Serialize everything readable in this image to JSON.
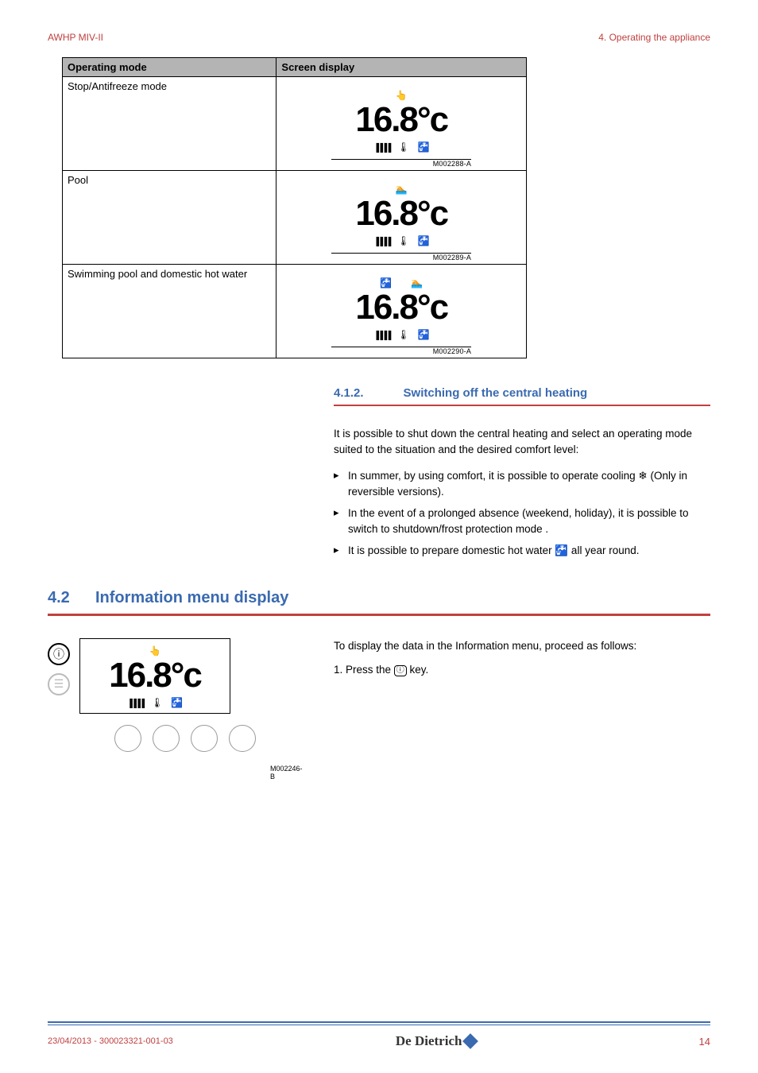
{
  "header": {
    "left": "AWHP MIV-II",
    "right": "4.  Operating the appliance"
  },
  "table": {
    "headers": {
      "mode": "Operating mode",
      "display": "Screen display"
    },
    "rows": [
      {
        "mode": "Stop/Antifreeze mode",
        "top_icons": [
          "hand"
        ],
        "temp": "16.8°c",
        "ref": "M002288-A"
      },
      {
        "mode": "Pool",
        "top_icons": [
          "pool"
        ],
        "temp": "16.8°c",
        "ref": "M002289-A"
      },
      {
        "mode": "Swimming pool and domestic hot water",
        "top_icons": [
          "tap",
          "pool"
        ],
        "temp": "16.8°c",
        "ref": "M002290-A"
      }
    ]
  },
  "subsection": {
    "num": "4.1.2.",
    "title": "Switching off the central heating",
    "intro": "It is possible to shut down the central heating and select an operating mode suited to the situation and the desired comfort level:",
    "bullets": [
      "In summer, by using comfort, it is possible to operate cooling ❄ (Only in reversible versions).",
      "In the event of a prolonged absence (weekend, holiday), it is possible to switch to shutdown/frost protection mode .",
      "It is possible to prepare domestic hot water 🚰 all year round."
    ]
  },
  "section": {
    "num": "4.2",
    "title": "Information menu display",
    "intro": "To display the data in the Information menu, proceed as follows:",
    "step1_prefix": "1.  Press the ",
    "step1_suffix": " key.",
    "panel_temp": "16.8°c",
    "illus_ref": "M002246-B"
  },
  "footer": {
    "left": "23/04/2013 - 300023321-001-03",
    "logo": "De Dietrich",
    "page": "14"
  }
}
